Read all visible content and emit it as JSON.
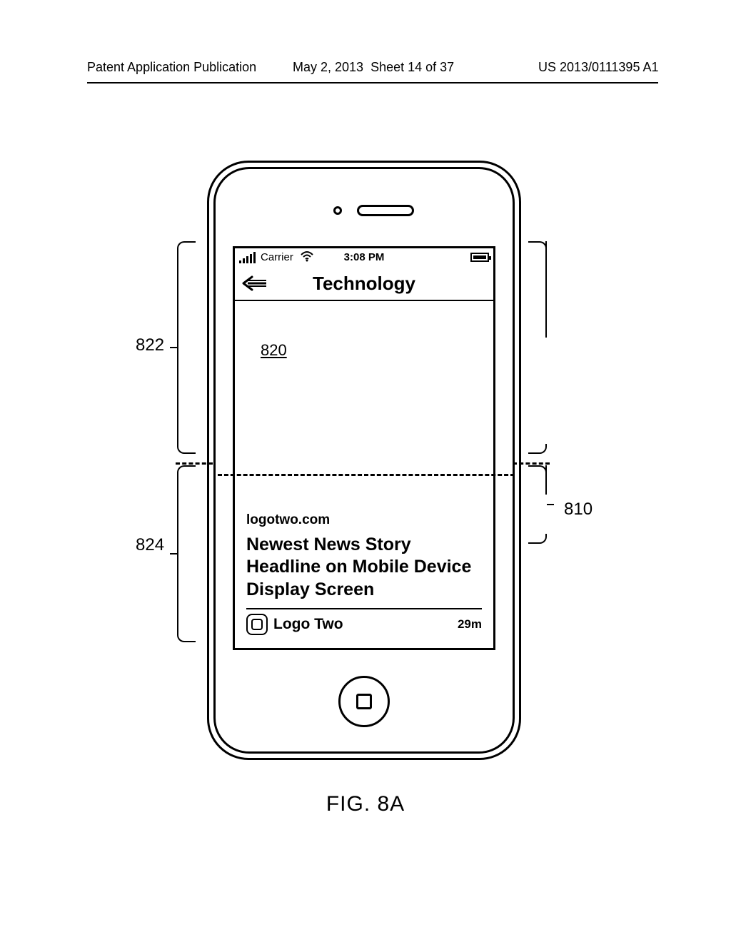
{
  "header": {
    "left": "Patent Application Publication",
    "date": "May 2, 2013",
    "sheet": "Sheet 14 of 37",
    "pubno": "US 2013/0111395 A1"
  },
  "statusbar": {
    "carrier": "Carrier",
    "time": "3:08 PM"
  },
  "titlebar": {
    "title": "Technology"
  },
  "refs": {
    "r820": "820",
    "r822": "822",
    "r824": "824",
    "r810": "810"
  },
  "story": {
    "source": "logotwo.com",
    "headline": "Newest News Story Headline on Mobile Device Display Screen",
    "logo_label": "Logo Two",
    "age": "29m"
  },
  "figure_label": "FIG. 8A"
}
